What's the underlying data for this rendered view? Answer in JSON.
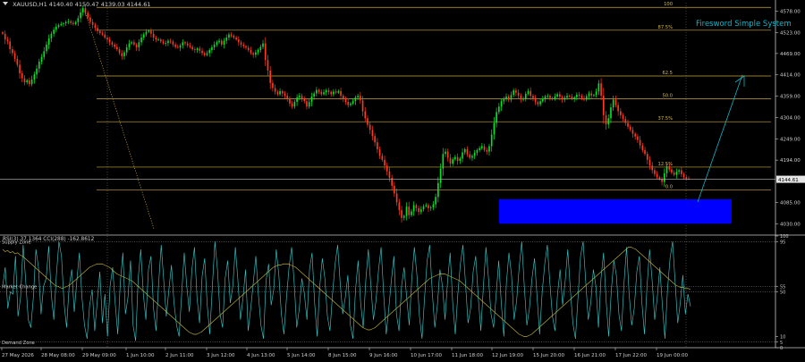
{
  "header": {
    "symbol": "XAUUSD,H1",
    "ohlc": "4140.40 4150.47 4139.03 4144.61"
  },
  "indicator_title": "Firesword Simple System",
  "subwindow": {
    "header": "RSI(3) 37.1364  CCI(288) -162.8612"
  },
  "chart_data": [
    {
      "type": "candlestick",
      "ylim": [
        4003,
        4607
      ],
      "y_ticks": [
        4578.0,
        4523.0,
        4469.0,
        4414.0,
        4359.0,
        4304.0,
        4249.0,
        4194.0,
        4140.0,
        4085.0,
        4030.0
      ],
      "current_price": {
        "label": "4144.61",
        "value": 4144.61
      },
      "fib_levels": [
        {
          "label": "100",
          "value": 4588
        },
        {
          "label": "87.5%",
          "value": 4529
        },
        {
          "label": "62.5",
          "value": 4411
        },
        {
          "label": "50.0",
          "value": 4352
        },
        {
          "label": "37.5%",
          "value": 4293
        },
        {
          "label": "12.5%",
          "value": 4176
        },
        {
          "label": "0.0",
          "value": 4117
        }
      ],
      "rectangle": {
        "value_top": 4093,
        "value_bottom": 4030,
        "color": "#0000ff"
      },
      "x_labels": [
        "27 May 2026",
        "28 May 08:00",
        "29 May 09:00",
        "1 Jun 10:00",
        "2 Jun 11:00",
        "3 Jun 12:00",
        "4 Jun 13:00",
        "5 Jun 14:00",
        "8 Jun 15:00",
        "9 Jun 16:00",
        "10 Jun 17:00",
        "11 Jun 18:00",
        "12 Jun 19:00",
        "15 Jun 20:00",
        "16 Jun 21:00",
        "17 Jun 22:00",
        "19 Jun 00:00"
      ],
      "path_close": [
        4520,
        4505,
        4500,
        4480,
        4470,
        4455,
        4440,
        4418,
        4405,
        4395,
        4400,
        4390,
        4402,
        4415,
        4430,
        4448,
        4460,
        4475,
        4492,
        4508,
        4520,
        4530,
        4538,
        4542,
        4545,
        4547,
        4550,
        4552,
        4548,
        4545,
        4550,
        4560,
        4575,
        4586,
        4574,
        4562,
        4550,
        4543,
        4535,
        4527,
        4522,
        4518,
        4510,
        4505,
        4498,
        4492,
        4486,
        4480,
        4470,
        4462,
        4472,
        4485,
        4495,
        4498,
        4492,
        4485,
        4498,
        4510,
        4518,
        4525,
        4528,
        4520,
        4510,
        4505,
        4505,
        4500,
        4495,
        4496,
        4502,
        4500,
        4492,
        4486,
        4484,
        4490,
        4498,
        4495,
        4490,
        4486,
        4480,
        4478,
        4482,
        4476,
        4470,
        4465,
        4470,
        4478,
        4485,
        4492,
        4498,
        4502,
        4492,
        4502,
        4510,
        4518,
        4515,
        4510,
        4505,
        4498,
        4492,
        4488,
        4484,
        4478,
        4470,
        4466,
        4472,
        4478,
        4486,
        4495,
        4452,
        4425,
        4393,
        4380,
        4370,
        4364,
        4372,
        4366,
        4360,
        4352,
        4340,
        4332,
        4344,
        4356,
        4360,
        4352,
        4346,
        4332,
        4344,
        4358,
        4366,
        4375,
        4370,
        4364,
        4369,
        4374,
        4370,
        4364,
        4371,
        4368,
        4372,
        4360,
        4352,
        4344,
        4336,
        4340,
        4346,
        4356,
        4360,
        4348,
        4320,
        4302,
        4285,
        4272,
        4256,
        4240,
        4222,
        4205,
        4195,
        4180,
        4165,
        4148,
        4128,
        4108,
        4085,
        4065,
        4045,
        4050,
        4074,
        4052,
        4062,
        4078,
        4070,
        4060,
        4067,
        4075,
        4078,
        4070,
        4072,
        4080,
        4099,
        4135,
        4172,
        4210,
        4216,
        4200,
        4185,
        4196,
        4202,
        4192,
        4198,
        4214,
        4222,
        4209,
        4200,
        4205,
        4213,
        4220,
        4225,
        4230,
        4220,
        4216,
        4230,
        4260,
        4290,
        4318,
        4332,
        4346,
        4352,
        4358,
        4350,
        4362,
        4374,
        4368,
        4360,
        4350,
        4352,
        4365,
        4372,
        4360,
        4354,
        4344,
        4338,
        4346,
        4352,
        4358,
        4360,
        4354,
        4352,
        4358,
        4364,
        4357,
        4350,
        4355,
        4360,
        4358,
        4352,
        4356,
        4363,
        4360,
        4354,
        4350,
        4359,
        4366,
        4361,
        4362,
        4371,
        4392,
        4360,
        4310,
        4286,
        4302,
        4330,
        4350,
        4336,
        4320,
        4310,
        4300,
        4290,
        4280,
        4272,
        4262,
        4255,
        4246,
        4232,
        4220,
        4210,
        4195,
        4180,
        4168,
        4158,
        4150,
        4145,
        4138,
        4160,
        4178,
        4170,
        4162,
        4156,
        4164,
        4168,
        4158,
        4150,
        4146,
        4145
      ]
    },
    {
      "type": "line",
      "ylim": [
        0,
        100
      ],
      "y_ticks": [
        100,
        95,
        55,
        50,
        10,
        5,
        0
      ],
      "levels": [
        {
          "label": "Supply Zone",
          "value": 95
        },
        {
          "label": "Market Change",
          "value": 55
        },
        {
          "label": "",
          "value": 50
        },
        {
          "label": "Demand Zone",
          "value": 5
        }
      ],
      "series": [
        {
          "color": "#37c5c5",
          "values": [
            55,
            72,
            35,
            50,
            48,
            82,
            28,
            45,
            92,
            60,
            25,
            18,
            45,
            88,
            72,
            30,
            55,
            62,
            91,
            48,
            25,
            65,
            95,
            82,
            40,
            18,
            55,
            70,
            32,
            60,
            85,
            45,
            20,
            8,
            38,
            52,
            15,
            42,
            68,
            22,
            48,
            10,
            55,
            72,
            40,
            12,
            58,
            85,
            30,
            45,
            78,
            20,
            6,
            62,
            88,
            48,
            25,
            70,
            82,
            35,
            15,
            58,
            92,
            60,
            28,
            52,
            74,
            40,
            20,
            10,
            48,
            85,
            55,
            32,
            70,
            90,
            45,
            22,
            64,
            80,
            38,
            12,
            55,
            95,
            70,
            30,
            18,
            62,
            78,
            40,
            55,
            90,
            60,
            25,
            45,
            70,
            15,
            35,
            58,
            82,
            48,
            20,
            8,
            60,
            75,
            38,
            52,
            88,
            65,
            30,
            12,
            45,
            72,
            90,
            58,
            18,
            35,
            62,
            48,
            25,
            70,
            85,
            40,
            10,
            55,
            80,
            62,
            28,
            15,
            48,
            75,
            92,
            58,
            30,
            45,
            65,
            20,
            8,
            52,
            78,
            40,
            18,
            60,
            88,
            55,
            25,
            42,
            70,
            90,
            48,
            12,
            35,
            60,
            82,
            30,
            15,
            55,
            72,
            45,
            20,
            62,
            90,
            65,
            28,
            8,
            45,
            78,
            92,
            50,
            18,
            38,
            70,
            55,
            25,
            60,
            85,
            40,
            12,
            48,
            75,
            92,
            58,
            22,
            35,
            68,
            82,
            45,
            15,
            55,
            90,
            62,
            30,
            18,
            48,
            78,
            40,
            10,
            58,
            85,
            65,
            25,
            42,
            72,
            95,
            55,
            20,
            35,
            62,
            80,
            45,
            12,
            50,
            75,
            92,
            58,
            28,
            15,
            48,
            70,
            38,
            60,
            88,
            52,
            22,
            8,
            45,
            82,
            95,
            60,
            25,
            40,
            70,
            55,
            18,
            62,
            85,
            42,
            10,
            50,
            78,
            65,
            30,
            15,
            58,
            90,
            48,
            20,
            35,
            68,
            82,
            40,
            12,
            55,
            88,
            60,
            25,
            45,
            72,
            38,
            8,
            52,
            80,
            95,
            58,
            22,
            40,
            65,
            30,
            48,
            37
          ]
        },
        {
          "color": "#bfb33a",
          "values": [
            88,
            86,
            87,
            85,
            86,
            84,
            85,
            83,
            82,
            80,
            78,
            76,
            74,
            72,
            70,
            68,
            66,
            64,
            62,
            60,
            58,
            56,
            55,
            54,
            53,
            54,
            55,
            56,
            58,
            60,
            62,
            64,
            66,
            68,
            70,
            72,
            73,
            74,
            75,
            75,
            75,
            74,
            73,
            72,
            70,
            68,
            66,
            65,
            64,
            63,
            62,
            61,
            60,
            58,
            56,
            54,
            52,
            50,
            48,
            46,
            44,
            42,
            40,
            38,
            36,
            34,
            32,
            30,
            28,
            26,
            24,
            22,
            20,
            18,
            16,
            14,
            13,
            12,
            12,
            13,
            14,
            16,
            18,
            20,
            22,
            24,
            26,
            28,
            30,
            32,
            34,
            36,
            38,
            40,
            42,
            44,
            46,
            48,
            50,
            52,
            54,
            56,
            58,
            60,
            62,
            64,
            66,
            68,
            70,
            72,
            73,
            74,
            74,
            75,
            75,
            75,
            74,
            73,
            72,
            70,
            68,
            66,
            64,
            62,
            60,
            58,
            56,
            54,
            52,
            50,
            48,
            46,
            44,
            42,
            40,
            38,
            36,
            34,
            32,
            30,
            28,
            26,
            24,
            22,
            20,
            18,
            17,
            16,
            16,
            17,
            18,
            20,
            22,
            24,
            26,
            28,
            30,
            32,
            34,
            36,
            38,
            40,
            42,
            44,
            46,
            48,
            50,
            52,
            54,
            56,
            58,
            60,
            62,
            63,
            64,
            65,
            66,
            66,
            66,
            65,
            64,
            63,
            62,
            61,
            60,
            58,
            56,
            54,
            52,
            50,
            48,
            46,
            44,
            42,
            40,
            38,
            36,
            34,
            32,
            30,
            28,
            26,
            24,
            22,
            20,
            18,
            16,
            14,
            12,
            11,
            10,
            10,
            11,
            12,
            14,
            16,
            18,
            20,
            22,
            24,
            26,
            28,
            30,
            32,
            34,
            36,
            38,
            40,
            42,
            44,
            46,
            48,
            50,
            52,
            54,
            56,
            58,
            60,
            62,
            64,
            66,
            68,
            70,
            72,
            74,
            76,
            78,
            80,
            82,
            84,
            86,
            88,
            90,
            90,
            89,
            88,
            86,
            84,
            82,
            80,
            78,
            76,
            74,
            72,
            70,
            68,
            66,
            64,
            62,
            60,
            58,
            56,
            55,
            54,
            54,
            53,
            53,
            52
          ]
        }
      ]
    }
  ]
}
